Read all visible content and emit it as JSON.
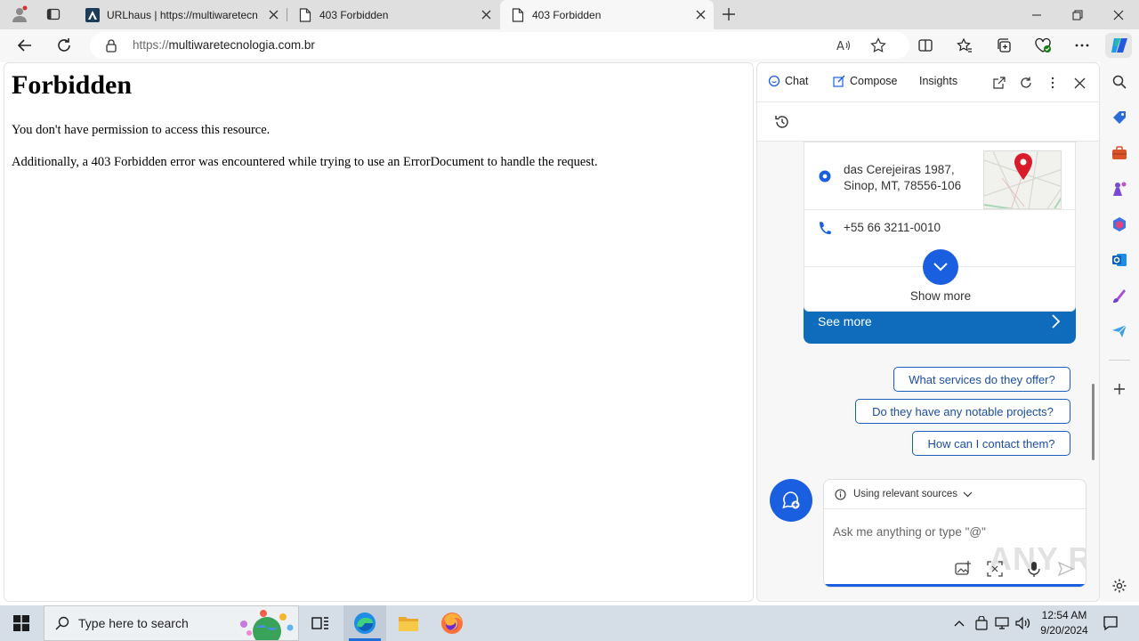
{
  "browser": {
    "tabs": [
      {
        "title": "URLhaus | https://multiwaretecn",
        "favicon": "urlhaus-icon",
        "active": false
      },
      {
        "title": "403 Forbidden",
        "favicon": "page-icon",
        "active": false
      },
      {
        "title": "403 Forbidden",
        "favicon": "page-icon",
        "active": true
      }
    ],
    "address": {
      "scheme": "https://",
      "host": "multiwaretecnologia.com.br"
    }
  },
  "page": {
    "heading": "Forbidden",
    "paragraph1": "You don't have permission to access this resource.",
    "paragraph2": "Additionally, a 403 Forbidden error was encountered while trying to use an ErrorDocument to handle the request."
  },
  "copilot": {
    "tabs": {
      "chat": "Chat",
      "compose": "Compose",
      "insights": "Insights"
    },
    "card": {
      "address_line1": "das Cerejeiras 1987,",
      "address_line2": "Sinop, MT, 78556-106",
      "phone": "+55 66 3211-0010",
      "show_more": "Show more",
      "see_more": "See more"
    },
    "suggestions": [
      "What services do they offer?",
      "Do they have any notable projects?",
      "How can I contact them?"
    ],
    "sources_label": "Using relevant sources",
    "input_placeholder": "Ask me anything or type \"@\"",
    "watermark": "ANY RUN"
  },
  "taskbar": {
    "search_placeholder": "Type here to search",
    "time": "12:54 AM",
    "date": "9/20/2024"
  },
  "colors": {
    "accent": "#1a5fe0",
    "card_blue": "#0f6cbd",
    "chip_border": "#1b5fbd"
  }
}
